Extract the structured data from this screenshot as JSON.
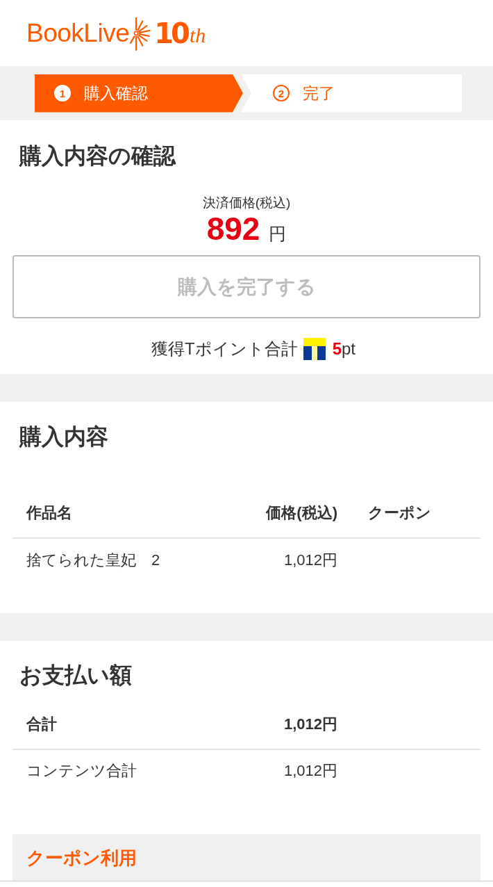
{
  "header": {
    "logo": {
      "wordmark": "BookLive",
      "anniversary_number": "10",
      "anniversary_suffix": "th"
    }
  },
  "steps": [
    {
      "number": "1",
      "label": "購入確認",
      "selected": true
    },
    {
      "number": "2",
      "label": "完了",
      "selected": false
    }
  ],
  "confirm": {
    "title": "購入内容の確認",
    "price_label": "決済価格(税込)",
    "price": "892",
    "currency": "円",
    "button": {
      "label": "購入を完了する",
      "disabled": true
    },
    "points": {
      "label": "獲得Tポイント合計",
      "value": "5",
      "unit": "pt"
    }
  },
  "purchase": {
    "title": "購入内容",
    "table": {
      "columns": [
        "作品名",
        "価格(税込)",
        "クーポン"
      ],
      "rows": [
        {
          "title": "捨てられた皇妃　2",
          "price": "1,012円"
        }
      ]
    }
  },
  "payment": {
    "title": "お支払い額",
    "rows": [
      {
        "kind": "total",
        "label": "合計",
        "amount": "1,012円"
      },
      {
        "kind": "item",
        "label": "コンテンツ合計",
        "amount": "1,012円"
      }
    ]
  },
  "coupon": {
    "title": "クーポン利用"
  }
}
